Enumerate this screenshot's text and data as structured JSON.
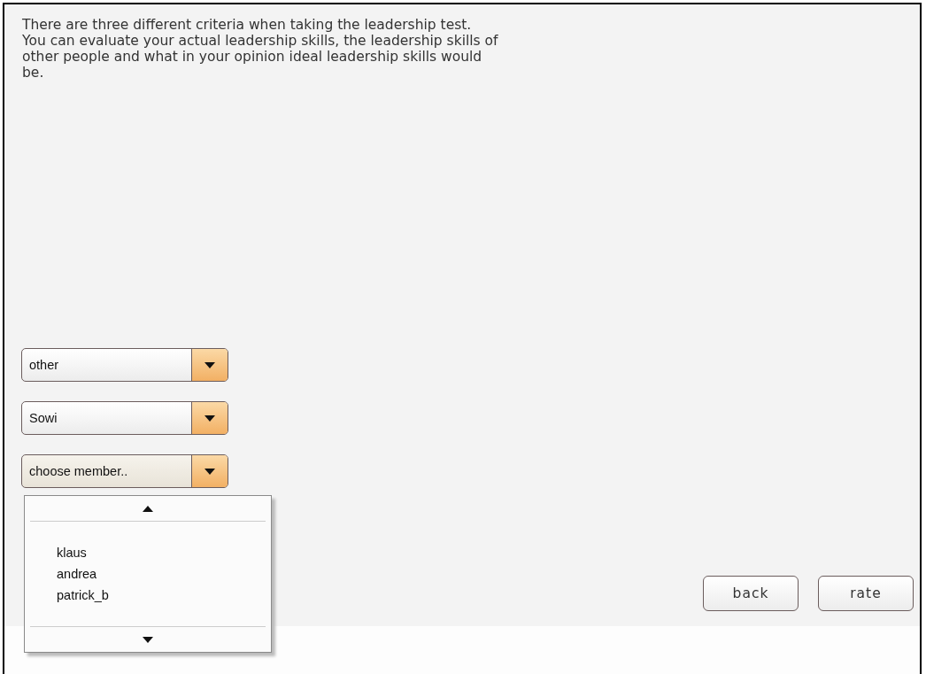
{
  "intro_lines": [
    "There are three different criteria when taking the leadership test.",
    "You can evaluate your actual leadership skills, the leadership skills of",
    "other people and what in your opinion ideal leadership skills would",
    "be."
  ],
  "dropdowns": [
    {
      "value": "other",
      "expanded": false
    },
    {
      "value": "Sowi",
      "expanded": false
    },
    {
      "value": "choose member..",
      "expanded": true
    }
  ],
  "member_options": [
    "klaus",
    "andrea",
    "patrick_b"
  ],
  "buttons": [
    "back",
    "rate"
  ]
}
